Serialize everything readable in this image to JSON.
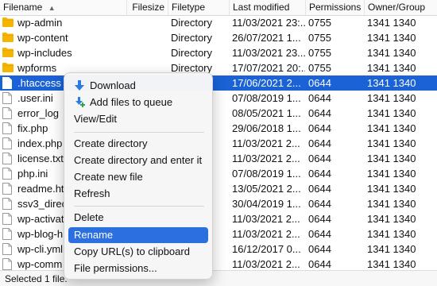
{
  "columns": {
    "filename": "Filename",
    "filesize": "Filesize",
    "filetype": "Filetype",
    "last_modified": "Last modified",
    "permissions": "Permissions",
    "owner_group": "Owner/Group"
  },
  "colors": {
    "selection": "#1a62d6",
    "menu_highlight": "#2b6fe0",
    "folder": "#f5b400"
  },
  "rows": [
    {
      "icon": "folder-icon",
      "name": "wp-admin",
      "size": "",
      "type": "Directory",
      "modified": "11/03/2021 23:...",
      "perm": "0755",
      "owner": "1341 1340"
    },
    {
      "icon": "folder-icon",
      "name": "wp-content",
      "size": "",
      "type": "Directory",
      "modified": "26/07/2021 1...",
      "perm": "0755",
      "owner": "1341 1340"
    },
    {
      "icon": "folder-icon",
      "name": "wp-includes",
      "size": "",
      "type": "Directory",
      "modified": "11/03/2021 23...",
      "perm": "0755",
      "owner": "1341 1340"
    },
    {
      "icon": "folder-icon",
      "name": "wpforms",
      "size": "",
      "type": "Directory",
      "modified": "17/07/2021 20:...",
      "perm": "0755",
      "owner": "1341 1340"
    },
    {
      "icon": "file-icon",
      "name": ".htaccess",
      "size": "",
      "type": "",
      "modified": "17/06/2021 2...",
      "perm": "0644",
      "owner": "1341 1340",
      "selected": true
    },
    {
      "icon": "file-icon",
      "name": ".user.ini",
      "size": "",
      "type": "",
      "modified": "07/08/2019 1...",
      "perm": "0644",
      "owner": "1341 1340"
    },
    {
      "icon": "file-icon",
      "name": "error_log",
      "size": "",
      "type": "",
      "modified": "08/05/2021 1...",
      "perm": "0644",
      "owner": "1341 1340"
    },
    {
      "icon": "file-icon",
      "name": "fix.php",
      "size": "",
      "type": "",
      "modified": "29/06/2018 1...",
      "perm": "0644",
      "owner": "1341 1340"
    },
    {
      "icon": "file-icon",
      "name": "index.php",
      "size": "",
      "type": "",
      "modified": "11/03/2021 2...",
      "perm": "0644",
      "owner": "1341 1340"
    },
    {
      "icon": "file-icon",
      "name": "license.txt",
      "size": "",
      "type": "",
      "modified": "11/03/2021 2...",
      "perm": "0644",
      "owner": "1341 1340"
    },
    {
      "icon": "file-icon",
      "name": "php.ini",
      "size": "",
      "type": "",
      "modified": "07/08/2019 1...",
      "perm": "0644",
      "owner": "1341 1340"
    },
    {
      "icon": "file-icon",
      "name": "readme.htm",
      "size": "",
      "type": "",
      "modified": "13/05/2021 2...",
      "perm": "0644",
      "owner": "1341 1340"
    },
    {
      "icon": "file-icon",
      "name": "ssv3_direc",
      "size": "",
      "type": "",
      "modified": "30/04/2019 1...",
      "perm": "0644",
      "owner": "1341 1340"
    },
    {
      "icon": "file-icon",
      "name": "wp-activat",
      "size": "",
      "type": "",
      "modified": "11/03/2021 2...",
      "perm": "0644",
      "owner": "1341 1340"
    },
    {
      "icon": "file-icon",
      "name": "wp-blog-h",
      "size": "",
      "type": "",
      "modified": "11/03/2021 2...",
      "perm": "0644",
      "owner": "1341 1340"
    },
    {
      "icon": "file-icon",
      "name": "wp-cli.yml",
      "size": "",
      "type": "",
      "modified": "16/12/2017 0...",
      "perm": "0644",
      "owner": "1341 1340"
    },
    {
      "icon": "file-icon",
      "name": "wp-comm",
      "size": "",
      "type": "",
      "modified": "11/03/2021 2...",
      "perm": "0644",
      "owner": "1341 1340"
    }
  ],
  "menu": {
    "download": "Download",
    "add_to_queue": "Add files to queue",
    "view_edit": "View/Edit",
    "create_directory": "Create directory",
    "create_directory_enter": "Create directory and enter it",
    "create_new_file": "Create new file",
    "refresh": "Refresh",
    "delete": "Delete",
    "rename": "Rename",
    "copy_urls": "Copy URL(s) to clipboard",
    "file_permissions": "File permissions..."
  },
  "status": {
    "text": "Selected 1 file."
  }
}
